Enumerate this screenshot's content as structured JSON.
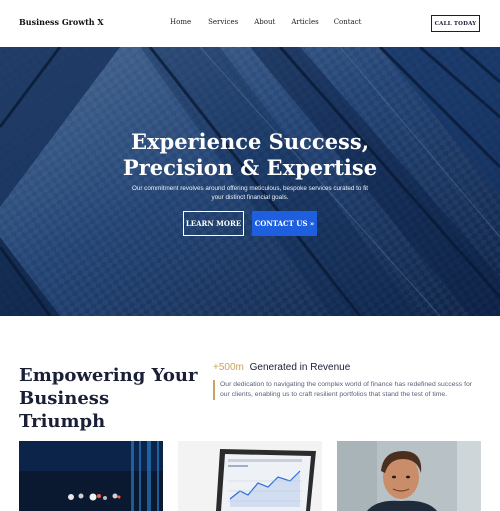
{
  "header": {
    "brand": "Business Growth X",
    "nav": [
      "Home",
      "Services",
      "About",
      "Articles",
      "Contact"
    ],
    "cta": "CALL TODAY"
  },
  "hero": {
    "title_line1": "Experience Success,",
    "title_line2": "Precision & Expertise",
    "subtitle": "Our commitment revolves around offering meticulous, bespoke services curated to fit your distinct financial goals.",
    "learn_more": "LEARN MORE",
    "contact_us": "CONTACT US »"
  },
  "section": {
    "title_line1": "Empowering Your",
    "title_line2": "Business Triumph",
    "stat_value": "+500m",
    "stat_label": "Generated in Revenue",
    "description": "Our dedication to navigating the complex world of finance has redefined success for our clients, enabling us to craft resilient portfolios that stand the test of time."
  },
  "colors": {
    "accent_blue": "#1e5fe0",
    "accent_gold": "#c9a45c",
    "navy": "#1a1f36"
  }
}
